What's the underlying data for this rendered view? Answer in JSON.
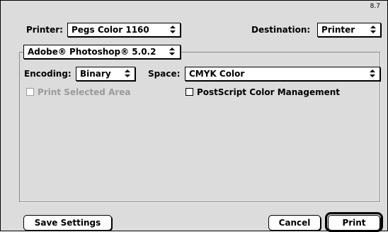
{
  "dialog": {
    "version": "8.7",
    "printer_label": "Printer:",
    "printer_value": "Pegs Color 1160",
    "destination_label": "Destination:",
    "destination_value": "Printer",
    "plugin_value": "Adobe® Photoshop® 5.0.2",
    "encoding_label": "Encoding:",
    "encoding_value": "Binary",
    "space_label": "Space:",
    "space_value": "CMYK Color",
    "print_selected_area": {
      "label": "Print Selected Area",
      "checked": false,
      "enabled": false
    },
    "postscript_cm": {
      "label": "PostScript Color Management",
      "checked": false,
      "enabled": true
    },
    "save_settings_label": "Save Settings",
    "cancel_label": "Cancel",
    "print_label": "Print"
  },
  "icons": {
    "popup_arrow": "up-down-arrows-icon"
  }
}
